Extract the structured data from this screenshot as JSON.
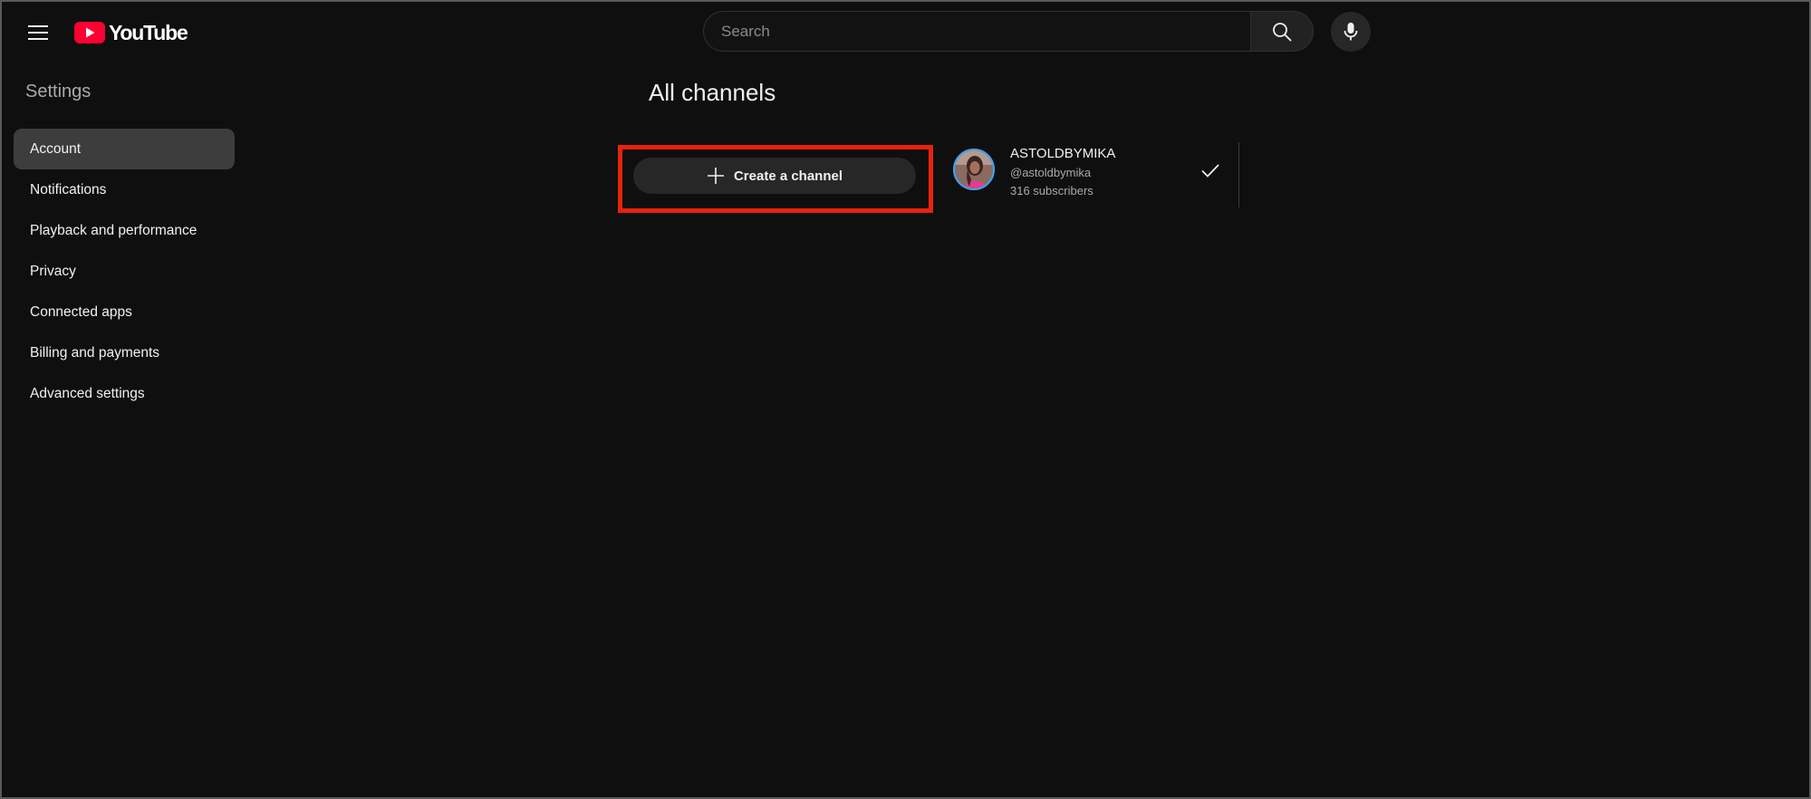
{
  "header": {
    "logo_text": "YouTube",
    "search": {
      "placeholder": "Search",
      "value": ""
    },
    "icons": {
      "menu": "hamburger-menu-icon",
      "logo": "youtube-logo-icon",
      "search": "search-icon",
      "mic": "microphone-icon"
    }
  },
  "sidebar": {
    "title": "Settings",
    "items": [
      {
        "label": "Account",
        "active": true
      },
      {
        "label": "Notifications",
        "active": false
      },
      {
        "label": "Playback and performance",
        "active": false
      },
      {
        "label": "Privacy",
        "active": false
      },
      {
        "label": "Connected apps",
        "active": false
      },
      {
        "label": "Billing and payments",
        "active": false
      },
      {
        "label": "Advanced settings",
        "active": false
      }
    ]
  },
  "main": {
    "title": "All channels",
    "create_button": {
      "label": "Create a channel",
      "icon": "plus-icon"
    },
    "channels": [
      {
        "name": "ASTOLDBYMIKA",
        "handle": "@astoldbymika",
        "subscribers": "316 subscribers",
        "selected": true
      }
    ]
  },
  "colors": {
    "background": "#0f0f0f",
    "brand_red": "#ff0033",
    "highlight_border": "#e8220c",
    "active_item": "#3d3d3d",
    "avatar_ring": "#3ea6ff"
  }
}
